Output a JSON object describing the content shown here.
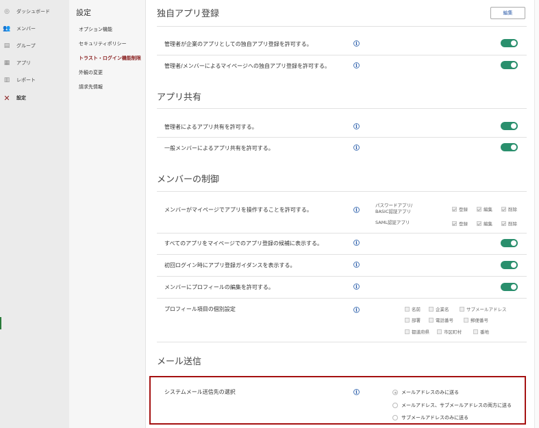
{
  "sidebar": {
    "items": [
      {
        "label": "ダッシュボード",
        "icon": "dashboard-icon"
      },
      {
        "label": "メンバー",
        "icon": "members-icon"
      },
      {
        "label": "グループ",
        "icon": "group-icon"
      },
      {
        "label": "アプリ",
        "icon": "apps-icon"
      },
      {
        "label": "レポート",
        "icon": "report-icon"
      },
      {
        "label": "設定",
        "icon": "settings-icon"
      }
    ],
    "active": "設定"
  },
  "subnav": {
    "title": "設定",
    "items": [
      "オプション機能",
      "セキュリティポリシー",
      "トラスト・ログイン機能制限",
      "外観の変更",
      "請求先情報"
    ],
    "active": "トラスト・ログイン機能制限"
  },
  "sections": {
    "own_app": {
      "title": "独自アプリ登録",
      "edit_label": "編集",
      "rows": [
        {
          "label": "管理者が企業のアプリとしての独自アプリ登録を許可する。",
          "enabled": true
        },
        {
          "label": "管理者/メンバーによるマイページへの独自アプリ登録を許可する。",
          "enabled": true
        }
      ]
    },
    "app_share": {
      "title": "アプリ共有",
      "rows": [
        {
          "label": "管理者によるアプリ共有を許可する。",
          "enabled": true
        },
        {
          "label": "一般メンバーによるアプリ共有を許可する。",
          "enabled": true
        }
      ]
    },
    "member_control": {
      "title": "メンバーの制御",
      "operate_label": "メンバーがマイページでアプリを操作することを許可する。",
      "perm_rows": [
        {
          "label": "パスワードアプリ/\nBASIC認証アプリ",
          "options": [
            "登録",
            "編集",
            "削除"
          ]
        },
        {
          "label": "SAML認証アプリ",
          "options": [
            "登録",
            "編集",
            "削除"
          ]
        }
      ],
      "rows": [
        {
          "label": "すべてのアプリをマイページでのアプリ登録の候補に表示する。",
          "enabled": true
        },
        {
          "label": "初回ログイン時にアプリ登録ガイダンスを表示する。",
          "enabled": true
        },
        {
          "label": "メンバーにプロフィールの編集を許可する。",
          "enabled": true
        }
      ],
      "profile_label": "プロフィール項目の個別設定",
      "profile_fields": [
        "名前",
        "企業名",
        "サブメールアドレス",
        "部署",
        "電話番号",
        "郵便番号",
        "都道府県",
        "市区町村",
        "番地"
      ]
    },
    "mail": {
      "title": "メール送信",
      "dest_label": "システムメール送信先の選択",
      "options": [
        "メールアドレスのみに送る",
        "メールアドレス、サブメールアドレスの両方に送る",
        "サブメールアドレスのみに送る"
      ],
      "selected": "メールアドレスのみに送る"
    }
  },
  "info_glyph": "i",
  "colors": {
    "toggle_on": "#2a8f6d",
    "highlight": "#a41010",
    "active_subnav": "#8b2323"
  }
}
